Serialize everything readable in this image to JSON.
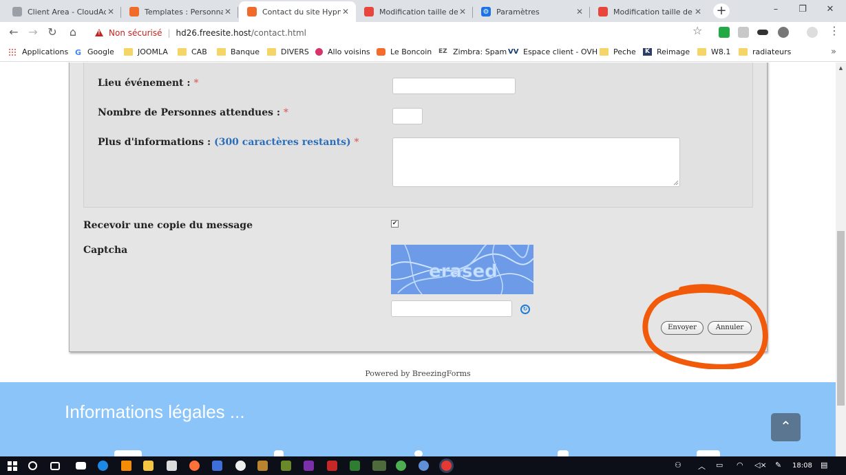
{
  "browser": {
    "tabs": [
      {
        "title": "Client Area - CloudAcce",
        "favicon": "cloud-icon",
        "active": false
      },
      {
        "title": "Templates : Personnalis",
        "favicon": "joomla-icon",
        "active": false
      },
      {
        "title": "Contact du site Hypno",
        "favicon": "joomla-icon",
        "active": true
      },
      {
        "title": "Modification taille de c",
        "favicon": "joomla-forum-icon",
        "active": false
      },
      {
        "title": "Paramètres",
        "favicon": "gear-icon",
        "active": false
      },
      {
        "title": "Modification taille de c",
        "favicon": "joomla-forum-icon",
        "active": false
      }
    ],
    "new_tab": "+",
    "window_controls": {
      "minimize": "–",
      "restore": "❐",
      "close": "✕"
    },
    "address": {
      "security_label": "Non sécurisé",
      "host": "hd26.freesite.host",
      "path": "/contact.html"
    },
    "bookmarks": [
      {
        "label": "Applications",
        "icon": "apps-grid-icon"
      },
      {
        "label": "Google",
        "icon": "google-icon"
      },
      {
        "label": "JOOMLA",
        "icon": "folder-icon"
      },
      {
        "label": "CAB",
        "icon": "folder-icon"
      },
      {
        "label": "Banque",
        "icon": "folder-icon"
      },
      {
        "label": "DIVERS",
        "icon": "folder-icon"
      },
      {
        "label": "Allo voisins",
        "icon": "allo-voisins-icon"
      },
      {
        "label": "Le Boncoin",
        "icon": "leboncoin-icon"
      },
      {
        "label": "Zimbra: Spam",
        "icon": "zimbra-icon"
      },
      {
        "label": "Espace client - OVH",
        "icon": "ovh-icon"
      },
      {
        "label": "Peche",
        "icon": "folder-icon"
      },
      {
        "label": "Reimage",
        "icon": "reimage-icon"
      },
      {
        "label": "W8.1",
        "icon": "folder-icon"
      },
      {
        "label": "radiateurs",
        "icon": "folder-icon"
      }
    ],
    "bookmarks_more": "»"
  },
  "form": {
    "lieu_label": "Lieu événement :",
    "personnes_label": "Nombre de Personnes attendues :",
    "infos_label": "Plus d'informations :",
    "infos_hint": "(300 caractères restants)",
    "required_mark": "*",
    "copie_label": "Recevoir une copie du message",
    "copie_checked": "✔",
    "captcha_label": "Captcha",
    "captcha_text": "erased",
    "refresh_glyph": "↻",
    "submit_label": "Envoyer",
    "cancel_label": "Annuler",
    "powered_by": "Powered by BreezingForms"
  },
  "footer": {
    "title": "Informations légales ...",
    "to_top": "⌃"
  },
  "taskbar": {
    "clock": "18:08"
  },
  "colors": {
    "annotation": "#f15a0a",
    "footer_bg": "#8ac4f9",
    "hint": "#2a6ebb",
    "required": "#d9534f"
  }
}
